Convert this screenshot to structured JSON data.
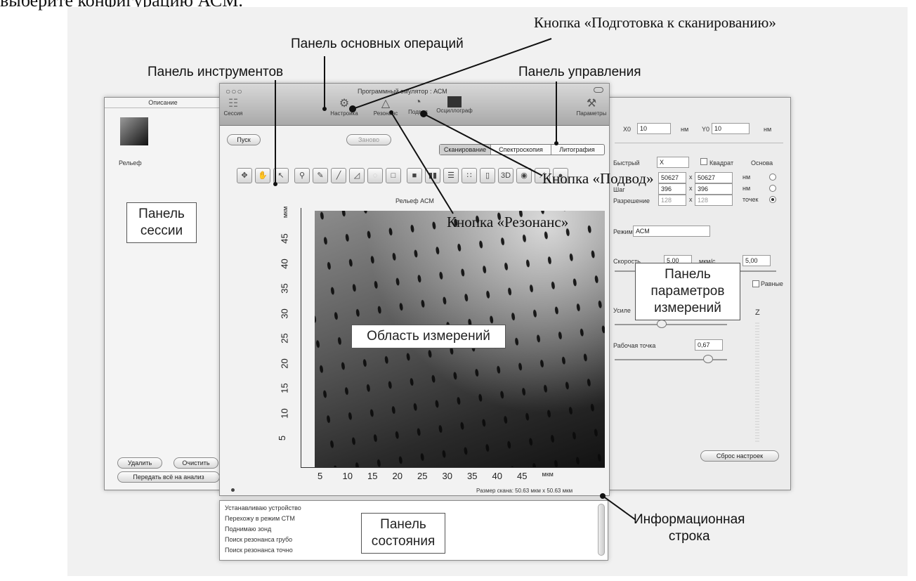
{
  "top_caption": "выберите конфигурацию АСМ.",
  "callouts": {
    "prep_button": "Кнопка «Подготовка к сканированию»",
    "main_ops": "Панель основных операций",
    "tools": "Панель инструментов",
    "control": "Панель управления",
    "approach_button": "Кнопка «Подвод»",
    "resonance_button": "Кнопка «Резонанс»",
    "session_panel": "Панель\nсессии",
    "measure_params": "Панель\nпараметров\nизмерений",
    "measure_area": "Область измерений",
    "status_panel": "Панель\nсостояния",
    "info_line": "Информационная\nстрока"
  },
  "session_window": {
    "header": "Описание",
    "thumb_label": "Рельеф",
    "buttons": {
      "delete": "Удалить",
      "clear": "Очистить",
      "send_all": "Передать всё на анализ"
    }
  },
  "main_window": {
    "title": "Программный эмулятор : АСМ",
    "toolbar": {
      "session": "Сессия",
      "setup": "Настройка",
      "resonance": "Резонанс",
      "approach": "Подвод",
      "oscilloscope": "Осциллограф",
      "params": "Параметры"
    },
    "start_button": "Пуск",
    "again_button": "Заново",
    "mode_tabs": [
      "Сканирование",
      "Спектроскопия",
      "Литография"
    ],
    "tool_3d": "3D",
    "image_title": "Рельеф АСМ",
    "x_ticks": [
      "5",
      "10",
      "15",
      "20",
      "25",
      "30",
      "35",
      "40",
      "45",
      "мкм"
    ],
    "y_ticks": [
      "5",
      "10",
      "15",
      "20",
      "25",
      "30",
      "35",
      "40",
      "45",
      "мкм"
    ],
    "info_text": "Размер скана: 50.63 мкм x 50.63 мкм"
  },
  "params_window": {
    "x0_label": "X0",
    "x0_value": "10",
    "x0_unit": "нм",
    "y0_label": "Y0",
    "y0_value": "10",
    "y0_unit": "нм",
    "fast_label": "Быстрый",
    "fast_value": "X",
    "square_label": "Квадрат",
    "base_label": "Основа",
    "size_x": "50627",
    "size_y": "50627",
    "size_unit": "нм",
    "step_label": "Шаг",
    "step_x": "396",
    "step_y": "396",
    "step_unit": "нм",
    "res_label": "Разрешение",
    "res_x": "128",
    "res_y": "128",
    "res_unit": "точек",
    "mode_label": "Режим",
    "mode_value": "АСМ",
    "speed_label": "Скорость",
    "speed_value": "5,00",
    "speed_unit": "мкм/с",
    "speed_value2": "5,00",
    "equal_label": "Равные",
    "gain_label": "Усиле",
    "z_label": "Z",
    "work_point_label": "Рабочая точка",
    "work_point_value": "0,67",
    "reset_button": "Сброс настроек"
  },
  "status_log": [
    "Устанавливаю устройство",
    "Перехожу в режим СТМ",
    "Поднимаю зонд",
    "Поиск резонанса грубо",
    "Поиск резонанса точно"
  ]
}
